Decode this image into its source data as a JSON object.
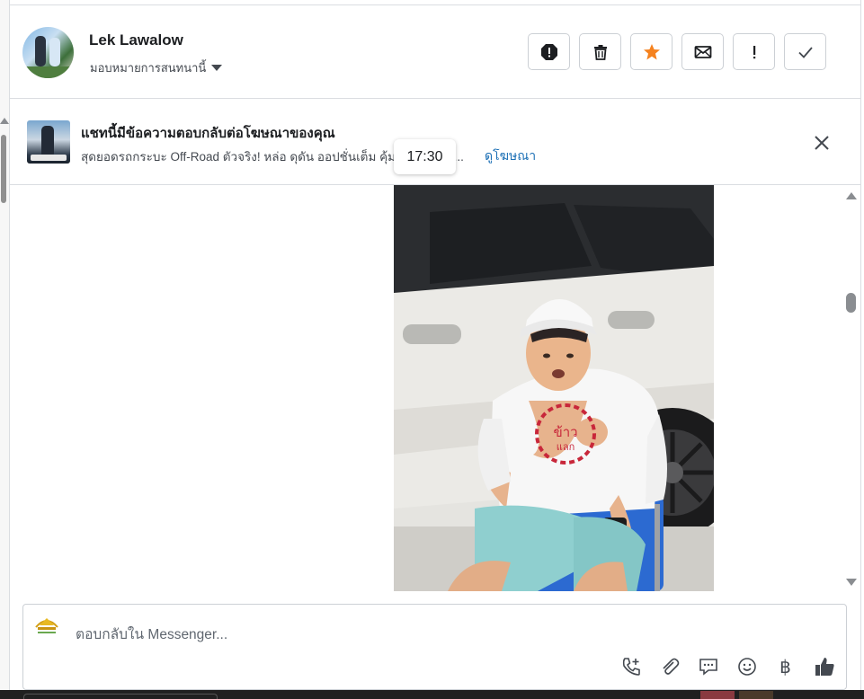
{
  "header": {
    "contact_name": "Lek Lawalow",
    "assign_label": "มอบหมายการสนทนานี้",
    "actions": [
      {
        "name": "spam-button",
        "icon": "octagon-exclamation-icon"
      },
      {
        "name": "delete-button",
        "icon": "trash-icon"
      },
      {
        "name": "star-button",
        "icon": "star-icon",
        "color": "#f5821f"
      },
      {
        "name": "mark-unread-button",
        "icon": "envelope-icon"
      },
      {
        "name": "follow-up-button",
        "icon": "exclamation-icon"
      },
      {
        "name": "mark-done-button",
        "icon": "check-icon"
      }
    ]
  },
  "ad_banner": {
    "title": "แชทนี้มีข้อความตอบกลับต่อโฆษณาของคุณ",
    "description": "สุดยอดรถกระบะ Off-Road ตัวจริง! หล่อ ดุดัน ออปชั่นเต็ม คุ้ม",
    "description_trail": "่เ...",
    "view_ad_link": "ดูโฆษณา"
  },
  "message": {
    "timestamp": "17:30",
    "photo_text": "ข้าว แลก"
  },
  "composer": {
    "placeholder": "ตอบกลับใน Messenger...",
    "tools": [
      "call-add-icon",
      "paperclip-icon",
      "chat-bubble-icon",
      "emoji-icon",
      "baht-icon",
      "thumbs-up-icon"
    ],
    "baht_symbol": "฿"
  },
  "colors": {
    "accent_link": "#1b6fb5",
    "star": "#f5821f",
    "like": "#444950"
  }
}
